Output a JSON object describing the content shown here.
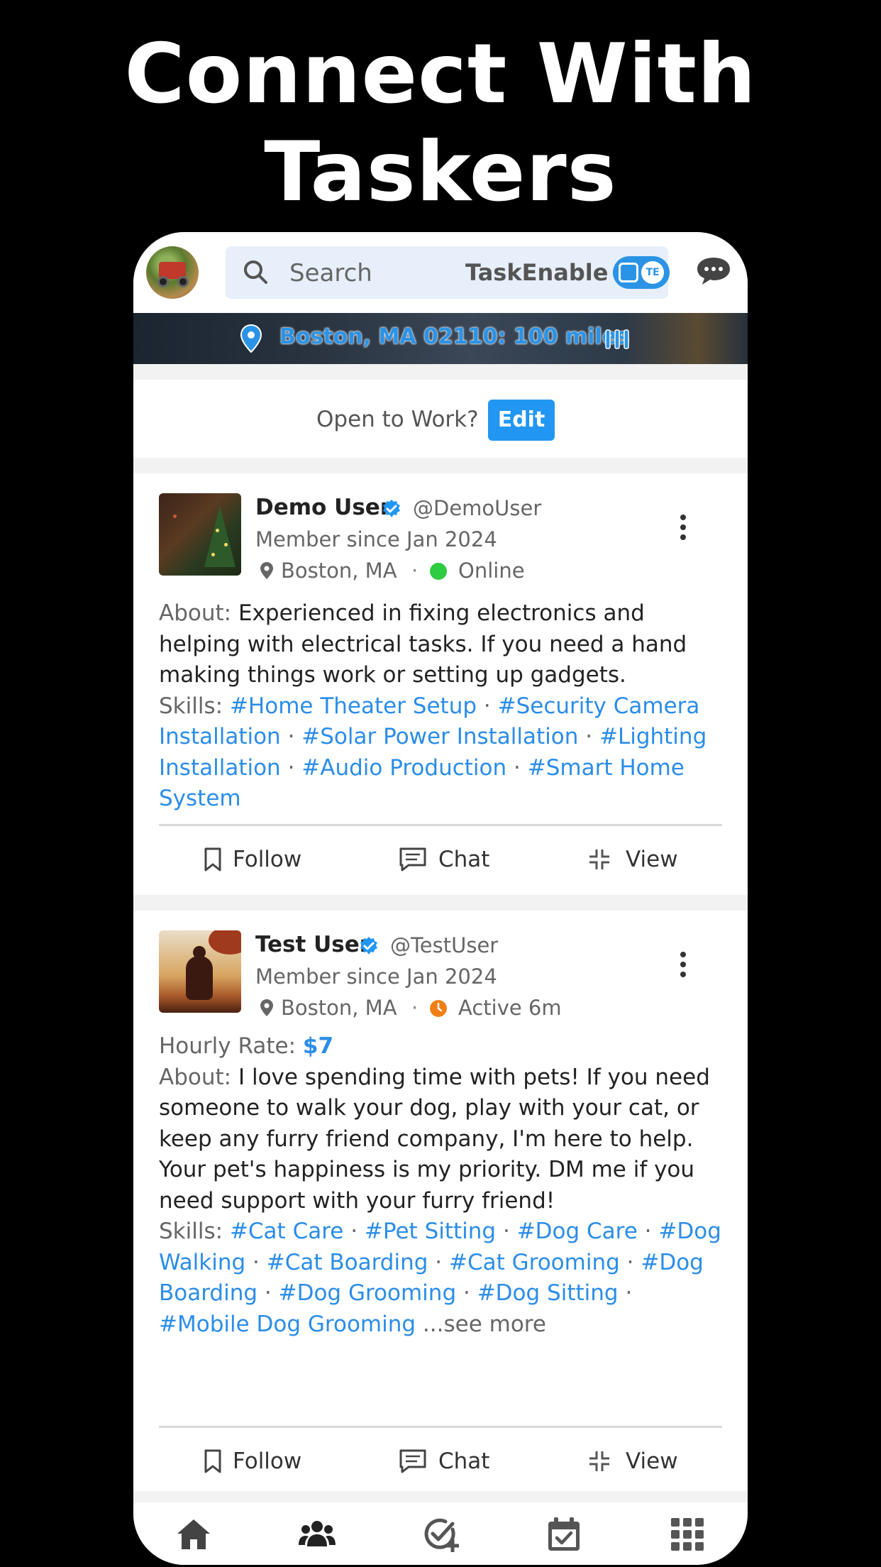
{
  "headline": {
    "line1": "Connect With",
    "line2": "Taskers"
  },
  "topbar": {
    "search_placeholder": "Search",
    "brand": "TaskEnable",
    "toggle_badge": "TE"
  },
  "banner": {
    "location": "Boston, MA 02110: 100 miles"
  },
  "open_to_work": {
    "question": "Open to Work?",
    "edit_label": "Edit"
  },
  "cards": [
    {
      "name": "Demo User",
      "handle": "@DemoUser",
      "member_since": "Member since Jan 2024",
      "city": "Boston, MA",
      "separator": "·",
      "status": "Online",
      "status_color": "#2ecc40",
      "about_label": "About:",
      "about": "Experienced in fixing electronics and helping with electrical tasks. If you need a hand making things work or setting up gadgets.",
      "skills_label": "Skills:",
      "skills": [
        "#Home Theater Setup",
        "#Security Camera Installation",
        "#Solar Power Installation",
        "#Lighting Installation",
        "#Audio Production",
        "#Smart Home System"
      ],
      "actions": {
        "follow": "Follow",
        "chat": "Chat",
        "view": "View"
      }
    },
    {
      "name": "Test User",
      "handle": "@TestUser",
      "member_since": "Member since Jan 2024",
      "city": "Boston, MA",
      "separator": "·",
      "status": "Active 6m",
      "status_color": "#f07d16",
      "rate_label": "Hourly Rate:",
      "rate": "$7",
      "about_label": "About:",
      "about": "I love spending time with pets! If you need someone to walk your dog, play with your cat, or keep any furry friend company, I'm here to help. Your pet's happiness is my priority. DM me if you need support with your furry friend!",
      "skills_label": "Skills:",
      "skills": [
        "#Cat Care",
        "#Pet Sitting",
        "#Dog Care",
        "#Dog Walking",
        "#Cat Boarding",
        "#Cat Grooming",
        "#Dog Boarding",
        "#Dog Grooming",
        "#Dog Sitting",
        "#Mobile Dog Grooming"
      ],
      "see_more": "...see more",
      "actions": {
        "follow": "Follow",
        "chat": "Chat",
        "view": "View"
      }
    }
  ],
  "colors": {
    "accent": "#2196f3",
    "tag": "#2b8de8"
  },
  "bottom_nav": [
    "home-icon",
    "people-icon",
    "add-task-icon",
    "calendar-check-icon",
    "apps-grid-icon"
  ]
}
